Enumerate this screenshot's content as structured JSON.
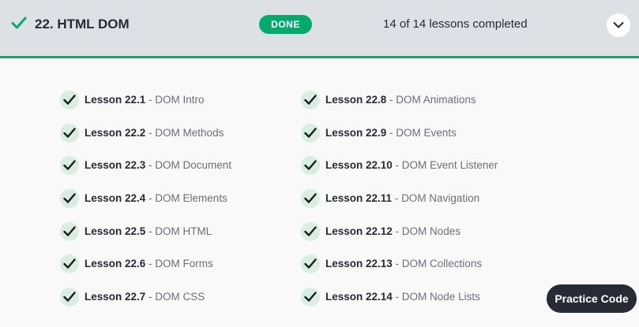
{
  "header": {
    "title": "22. HTML DOM",
    "status": "DONE",
    "progress": "14 of 14 lessons completed",
    "accent_color": "#04aa6d",
    "check_icon": "check-icon",
    "expand_icon": "chevron-down-icon"
  },
  "lessons": [
    {
      "number": "Lesson 22.1",
      "separator": " - ",
      "name": "DOM Intro"
    },
    {
      "number": "Lesson 22.2",
      "separator": " - ",
      "name": "DOM Methods"
    },
    {
      "number": "Lesson 22.3",
      "separator": " - ",
      "name": "DOM Document"
    },
    {
      "number": "Lesson 22.4",
      "separator": " - ",
      "name": "DOM Elements"
    },
    {
      "number": "Lesson 22.5",
      "separator": " - ",
      "name": "DOM HTML"
    },
    {
      "number": "Lesson 22.6",
      "separator": " - ",
      "name": "DOM Forms"
    },
    {
      "number": "Lesson 22.7",
      "separator": " - ",
      "name": "DOM CSS"
    },
    {
      "number": "Lesson 22.8",
      "separator": " - ",
      "name": "DOM Animations"
    },
    {
      "number": "Lesson 22.9",
      "separator": " - ",
      "name": "DOM Events"
    },
    {
      "number": "Lesson 22.10",
      "separator": " - ",
      "name": "DOM Event Listener"
    },
    {
      "number": "Lesson 22.11",
      "separator": " - ",
      "name": "DOM Navigation"
    },
    {
      "number": "Lesson 22.12",
      "separator": " - ",
      "name": "DOM Nodes"
    },
    {
      "number": "Lesson 22.13",
      "separator": " - ",
      "name": "DOM Collections"
    },
    {
      "number": "Lesson 22.14",
      "separator": " - ",
      "name": "DOM Node Lists"
    }
  ],
  "practice_button": {
    "label": "Practice Code"
  }
}
